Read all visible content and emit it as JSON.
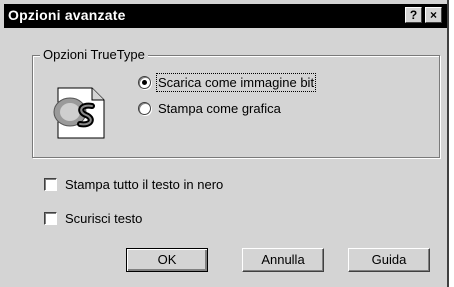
{
  "window": {
    "title": "Opzioni avanzate",
    "help_label": "?",
    "close_label": "×"
  },
  "truetype_group": {
    "legend": "Opzioni TrueType",
    "icon": "truetype-font-icon",
    "options": [
      {
        "label": "Scarica come immagine bit",
        "selected": true
      },
      {
        "label": "Stampa come grafica",
        "selected": false
      }
    ]
  },
  "checkboxes": [
    {
      "label": "Stampa tutto il testo in nero",
      "checked": false
    },
    {
      "label": "Scurisci testo",
      "checked": false
    }
  ],
  "buttons": {
    "ok": "OK",
    "cancel": "Annulla",
    "help": "Guida"
  },
  "colors": {
    "title_bar": "#000000",
    "dialog_face": "#d4d4d4"
  }
}
